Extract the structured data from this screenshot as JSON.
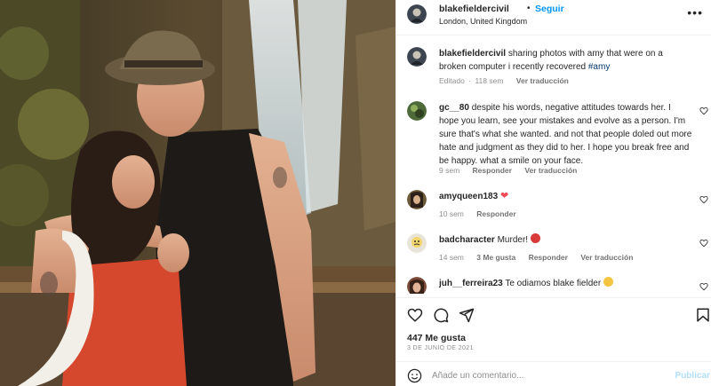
{
  "post": {
    "username": "blakefieldercivil",
    "dot": "•",
    "follow_label": "Seguir",
    "location": "London, United Kingdom",
    "more_icon": "ellipsis-icon"
  },
  "caption": {
    "username": "blakefieldercivil",
    "text": "sharing photos with amy that were on a broken computer i recently recovered",
    "hashtag": "#amy",
    "edited": "Editado",
    "dot": "·",
    "age": "118 sem",
    "translate": "Ver traducción"
  },
  "comments": [
    {
      "username": "gc__80",
      "text": "despite his words, negative attitudes towards her. I hope you learn, see your mistakes and evolve as a person. I'm sure that's what she wanted. and not that people doled out more hate and judgment as they did to her. I hope you break free and be happy. what a smile on your face.",
      "age": "9 sem",
      "reply": "Responder",
      "translate": "Ver traducción"
    },
    {
      "username": "amyqueen183",
      "text": "",
      "emoji": "❤",
      "age": "10 sem",
      "reply": "Responder"
    },
    {
      "username": "badcharacter",
      "text": "Murder!",
      "emoji_icon": "angry-face-emoji",
      "age": "14 sem",
      "likes": "3 Me gusta",
      "reply": "Responder",
      "translate": "Ver traducción"
    },
    {
      "username": "juh__ferreira23",
      "text": "Te odiamos blake fielder",
      "emoji_icon": "crying-face-emoji"
    }
  ],
  "stats": {
    "likes": "447 Me gusta",
    "date": "3 DE JUNIO DE 2021"
  },
  "add_comment": {
    "placeholder": "Añade un comentario...",
    "publish": "Publicar"
  },
  "colors": {
    "link_blue": "#0095f6",
    "hashtag": "#00376b",
    "muted": "#8e8e8e",
    "heart_red": "#ed4956",
    "publish_disabled": "#b2dffc"
  }
}
